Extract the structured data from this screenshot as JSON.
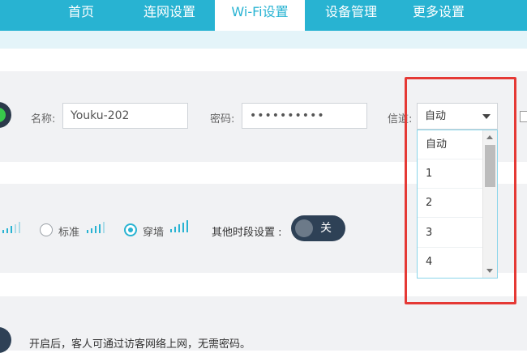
{
  "nav": {
    "tabs": [
      {
        "label": "首页"
      },
      {
        "label": "连网设置"
      },
      {
        "label": "Wi-Fi设置",
        "active": true
      },
      {
        "label": "设备管理"
      },
      {
        "label": "更多设置"
      }
    ]
  },
  "wifi": {
    "name_label": "名称:",
    "name_value": "Youku-202",
    "password_label": "密码:",
    "password_value": "••••••••••",
    "channel_label": "信道:",
    "channel_selected": "自动",
    "channel_options": [
      "自动",
      "1",
      "2",
      "3",
      "4"
    ]
  },
  "power": {
    "options": [
      {
        "label": "标准",
        "checked": false
      },
      {
        "label": "穿墙",
        "checked": true
      }
    ],
    "other_time_label": "其他时段设置 :",
    "other_time_toggle": "关"
  },
  "guest": {
    "description": "开启后，客人可通过访客网络上网，无需密码。"
  },
  "colors": {
    "accent": "#28b3d2",
    "highlight": "#e53935",
    "toggle_dark": "#2e4156",
    "on_green": "#38c94b"
  }
}
